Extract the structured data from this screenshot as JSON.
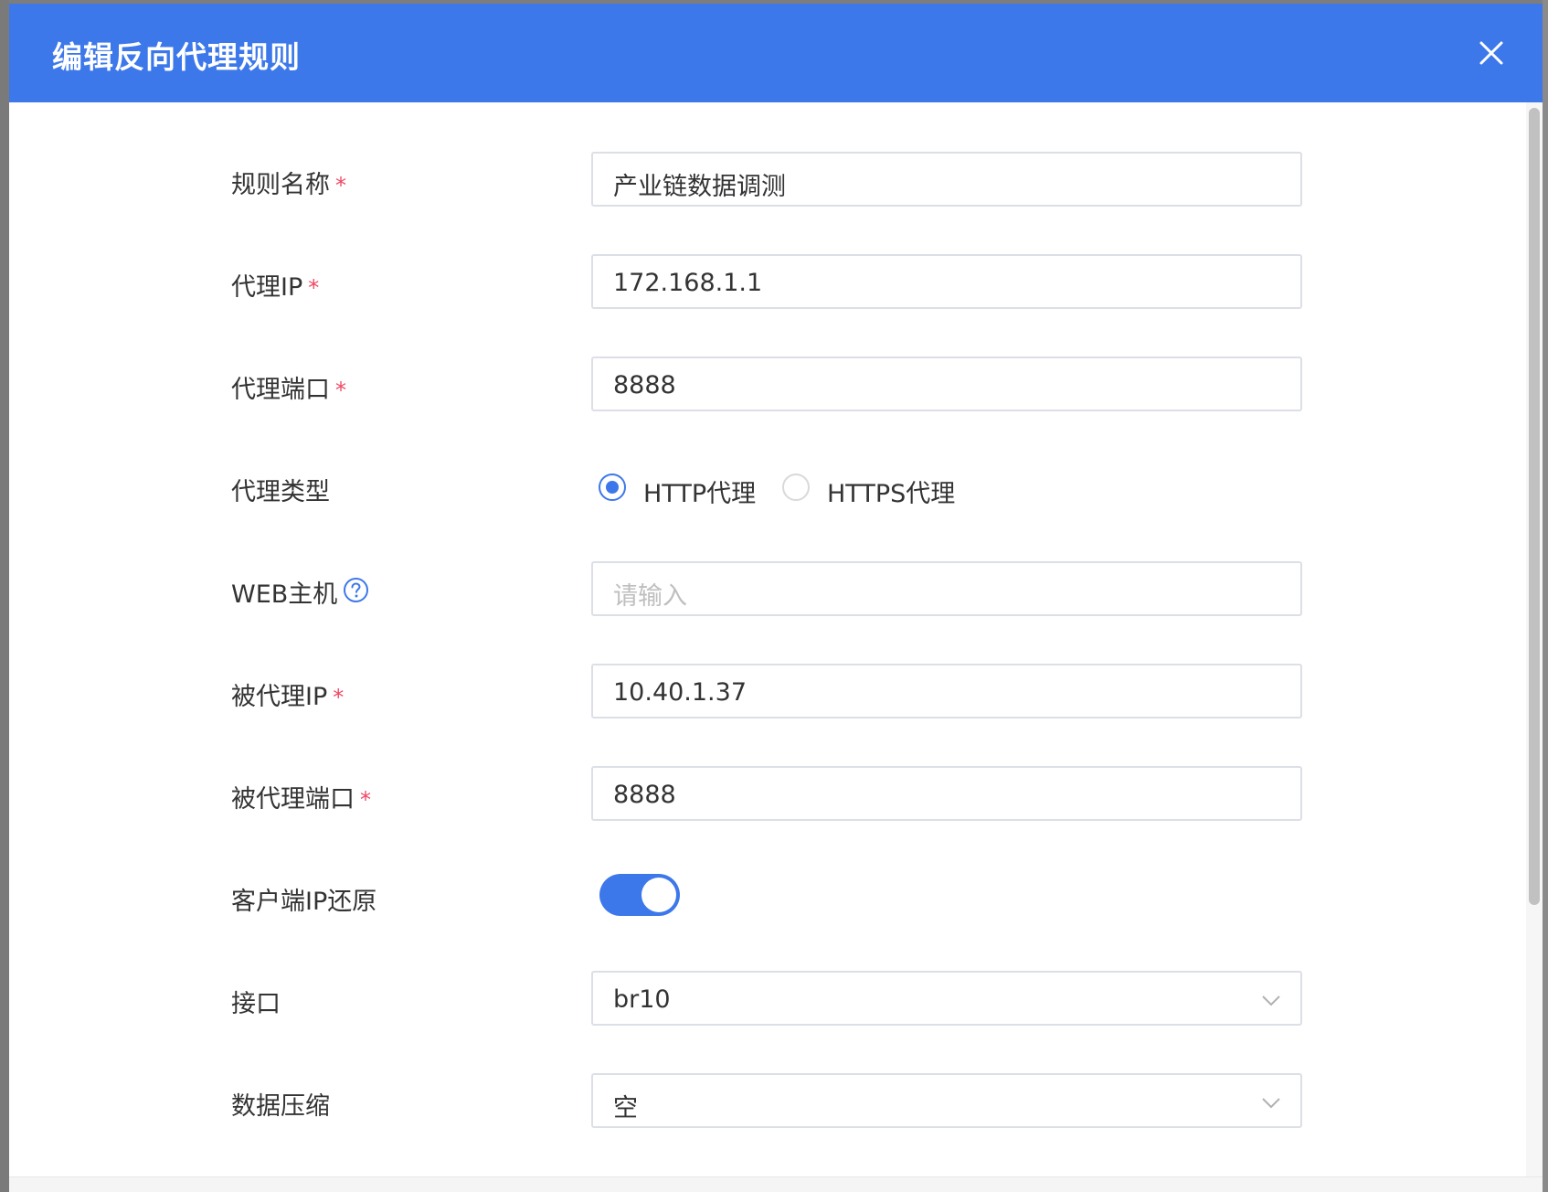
{
  "dialog": {
    "title": "编辑反向代理规则",
    "close_icon": "close-icon"
  },
  "form": {
    "rule_name": {
      "label": "规则名称",
      "required": "*",
      "value": "产业链数据调测"
    },
    "proxy_ip": {
      "label": "代理IP",
      "required": "*",
      "value": "172.168.1.1"
    },
    "proxy_port": {
      "label": "代理端口",
      "required": "*",
      "value": "8888"
    },
    "proxy_type": {
      "label": "代理类型",
      "options": [
        "HTTP代理",
        "HTTPS代理"
      ],
      "selected": "HTTP代理"
    },
    "web_host": {
      "label": "WEB主机",
      "placeholder": "请输入",
      "help_icon": "question-circle-icon"
    },
    "proxied_ip": {
      "label": "被代理IP",
      "required": "*",
      "value": "10.40.1.37"
    },
    "proxied_port": {
      "label": "被代理端口",
      "required": "*",
      "value": "8888"
    },
    "client_ip_restore": {
      "label": "客户端IP还原",
      "enabled": true
    },
    "interface": {
      "label": "接口",
      "value": "br10",
      "icon": "chevron-down-icon"
    },
    "data_compression": {
      "label": "数据压缩",
      "value": "空",
      "icon": "chevron-down-icon"
    }
  },
  "colors": {
    "primary": "#3d78ea",
    "required": "#f04864",
    "border": "#dcdfe6",
    "placeholder": "#bfbfbf"
  }
}
